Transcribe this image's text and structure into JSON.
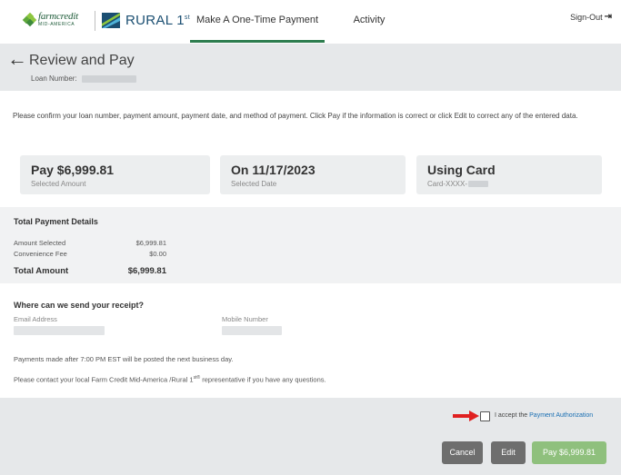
{
  "header": {
    "brand_primary": "farmcredit",
    "brand_primary_sub": "MID-AMERICA",
    "brand_secondary": "RURAL 1",
    "brand_secondary_sup": "st",
    "tabs": [
      {
        "label": "Make A One-Time Payment",
        "active": true
      },
      {
        "label": "Activity",
        "active": false
      }
    ],
    "signout_label": "Sign-Out"
  },
  "review": {
    "title": "Review and Pay",
    "loan_label": "Loan Number:"
  },
  "instructions": "Please confirm your loan number, payment amount, payment date, and method of payment. Click Pay if the information is correct or click Edit to correct any of the entered data.",
  "cards": [
    {
      "big": "Pay $6,999.81",
      "small": "Selected Amount"
    },
    {
      "big": "On 11/17/2023",
      "small": "Selected Date"
    },
    {
      "big": "Using Card",
      "small": "Card-XXXX-"
    }
  ],
  "totals": {
    "title": "Total Payment Details",
    "rows": [
      {
        "label": "Amount Selected",
        "value": "$6,999.81"
      },
      {
        "label": "Convenience Fee",
        "value": "$0.00"
      }
    ],
    "total_label": "Total Amount",
    "total_value": "$6,999.81"
  },
  "receipt": {
    "title": "Where can we send your receipt?",
    "email_label": "Email Address",
    "mobile_label": "Mobile Number"
  },
  "notes": {
    "cutoff": "Payments made after 7:00 PM EST will be posted the next business day.",
    "contact_pre": "Please contact your local Farm Credit Mid-America /Rural 1",
    "contact_sup": "st®",
    "contact_post": " representative if you have any questions."
  },
  "footer": {
    "accept_text": "I accept the",
    "accept_link": "Payment Authorization",
    "cancel_label": "Cancel",
    "edit_label": "Edit",
    "pay_label": "Pay $6,999.81"
  },
  "colors": {
    "nav_active": "#2e7d4f",
    "pay_button": "#8fc07d",
    "secondary_button": "#6e6e6e",
    "link": "#1a6fb3",
    "arrow_annotation": "#e02020"
  }
}
